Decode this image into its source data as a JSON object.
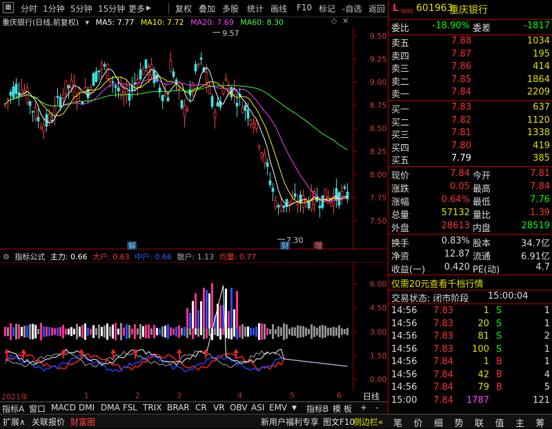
{
  "toolbar": {
    "items": [
      "分时",
      "1分钟",
      "5分钟",
      "15分钟",
      "更多",
      "复权",
      "叠加",
      "多股",
      "统计",
      "画线",
      "F10",
      "标记",
      "-自选",
      "返回"
    ],
    "dropdown_arrow": "▶"
  },
  "legend": {
    "stock_title": "重庆银行(日线,前复权)",
    "ma5": "MA5: 7.77",
    "ma10": "MA10: 7.72",
    "ma20": "MA20: 7.69",
    "ma60": "MA60: 8.30",
    "colors": {
      "ma5": "#ffffff",
      "ma10": "#ffff00",
      "ma20": "#ff00ff",
      "ma60": "#00ff00"
    }
  },
  "main_axis": {
    "ticks": [
      "9.50",
      "9.25",
      "9.00",
      "8.75",
      "8.50",
      "8.25",
      "8.00",
      "7.75",
      "7.50"
    ],
    "high_label": "9.57",
    "low_label": "7.30",
    "markers": [
      "解",
      "财",
      "增"
    ]
  },
  "indicator": {
    "name": "指标公式",
    "zhuli": "主力: 0.66",
    "dahu": "大户: 0.63",
    "zhonghu": "中户: 0.66",
    "sanhu": "散户: 1.13",
    "junliang": "均量: 0.77",
    "ticks": [
      "6.00",
      "4.50",
      "3.00",
      "1.50",
      "0.00"
    ]
  },
  "xaxis": {
    "labels": [
      "2021年",
      "1",
      "2",
      "3",
      "4",
      "5",
      "6"
    ],
    "right_label": "日线"
  },
  "tabs": [
    "指标A",
    "窗口",
    "MACD",
    "DMI",
    "DMA",
    "FSL",
    "TRIX",
    "BRAR",
    "CR",
    "VR",
    "OBV",
    "ASI",
    "EMV",
    "▼",
    "指标B",
    "模",
    "板",
    "+",
    "-"
  ],
  "statusbar": {
    "left": [
      "扩展∧",
      "关联报价",
      "财富圈"
    ],
    "promo": "新用户福利专享",
    "f10": "图文F10",
    "side": "侧边栏«"
  },
  "right": {
    "logo": "L",
    "code": "601963",
    "name": "重庆银行",
    "weibi_label": "委比",
    "weibi": "-18.90%",
    "weicha_label": "委差",
    "weicha": "-1817",
    "asks": [
      {
        "label": "卖五",
        "price": "7.88",
        "vol": "1034"
      },
      {
        "label": "卖四",
        "price": "7.87",
        "vol": "195"
      },
      {
        "label": "卖三",
        "price": "7.86",
        "vol": "414"
      },
      {
        "label": "卖二",
        "price": "7.85",
        "vol": "1864"
      },
      {
        "label": "卖一",
        "price": "7.84",
        "vol": "2209"
      }
    ],
    "bids": [
      {
        "label": "买一",
        "price": "7.83",
        "vol": "637"
      },
      {
        "label": "买二",
        "price": "7.82",
        "vol": "1120"
      },
      {
        "label": "买三",
        "price": "7.81",
        "vol": "1338"
      },
      {
        "label": "买四",
        "price": "7.80",
        "vol": "419"
      },
      {
        "label": "买五",
        "price": "7.79",
        "vol": "385"
      }
    ],
    "stats": [
      {
        "l1": "现价",
        "v1": "7.84",
        "l2": "今开",
        "v2": "7.81"
      },
      {
        "l1": "涨跌",
        "v1": "0.05",
        "l2": "最高",
        "v2": "7.84"
      },
      {
        "l1": "涨幅",
        "v1": "0.64%",
        "l2": "最低",
        "v2": "7.76"
      },
      {
        "l1": "总量",
        "v1": "57132",
        "l2": "量比",
        "v2": "1.39"
      },
      {
        "l1": "外盘",
        "v1": "28613",
        "l2": "内盘",
        "v2": "28519"
      }
    ],
    "stats2": [
      {
        "l1": "换手",
        "v1": "0.83%",
        "l2": "股本",
        "v2": "34.7亿"
      },
      {
        "l1": "净资",
        "v1": "12.87",
        "l2": "流通",
        "v2": "6.91亿"
      },
      {
        "l1": "收益(一)",
        "v1": "0.420",
        "l2": "PE(动)",
        "v2": "4.7"
      }
    ],
    "promo": "仅需20元查看千档行情",
    "status_label": "交易状态: 闭市阶段",
    "status_time": "15:00:04",
    "ticks": [
      {
        "t": "14:56",
        "p": "7.83",
        "v": "1",
        "d": "S",
        "n": "1"
      },
      {
        "t": "14:56",
        "p": "7.83",
        "v": "20",
        "d": "S",
        "n": "1"
      },
      {
        "t": "14:56",
        "p": "7.83",
        "v": "81",
        "d": "S",
        "n": "2"
      },
      {
        "t": "14:56",
        "p": "7.83",
        "v": "100",
        "d": "S",
        "n": "1"
      },
      {
        "t": "14:56",
        "p": "7.84",
        "v": "1",
        "d": "B",
        "n": "1"
      },
      {
        "t": "14:56",
        "p": "7.84",
        "v": "42",
        "d": "B",
        "n": "4"
      },
      {
        "t": "14:56",
        "p": "7.84",
        "v": "79",
        "d": "B",
        "n": "5"
      },
      {
        "t": "15:00",
        "p": "7.84",
        "v": "1787",
        "d": "",
        "n": "121"
      }
    ],
    "bottom_tabs": [
      "笔",
      "价",
      "细",
      "势",
      "联",
      "值",
      "主",
      "筹"
    ]
  }
}
